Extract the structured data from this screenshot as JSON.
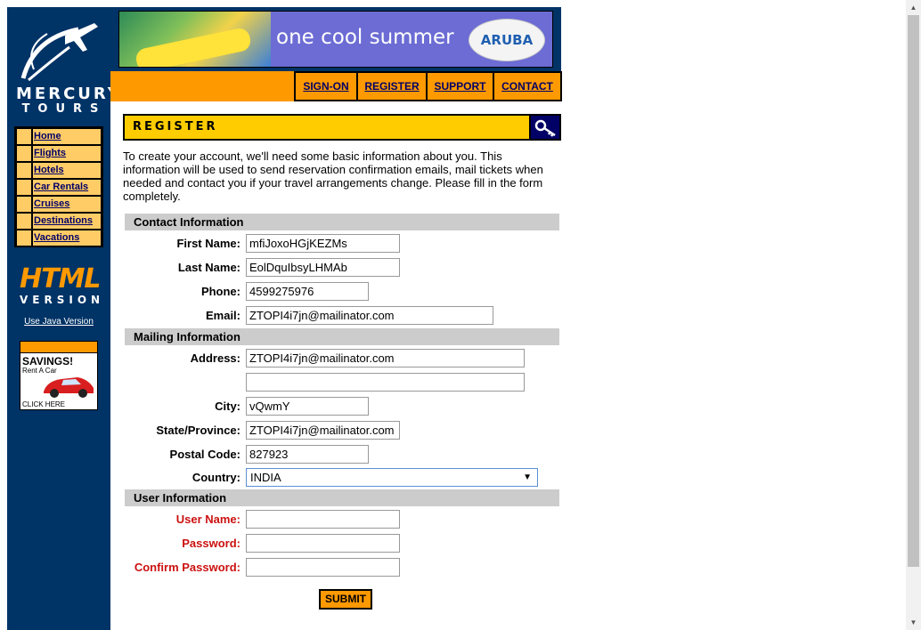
{
  "brand": {
    "line1": "MERCURY",
    "line2": "TOURS"
  },
  "sidebar": {
    "items": [
      {
        "label": "Home"
      },
      {
        "label": "Flights"
      },
      {
        "label": "Hotels"
      },
      {
        "label": "Car Rentals"
      },
      {
        "label": "Cruises"
      },
      {
        "label": "Destinations"
      },
      {
        "label": "Vacations"
      }
    ],
    "html_version_big": "HTML",
    "html_version_small": "VERSION",
    "java_link": "Use Java Version",
    "ad": {
      "headline": "SAVINGS!",
      "sub": "Rent A Car",
      "cta": "CLICK HERE"
    }
  },
  "banner": {
    "text": "one cool summer",
    "logo": "ARUBA"
  },
  "top_menu": [
    "SIGN-ON",
    "REGISTER",
    "SUPPORT",
    "CONTACT"
  ],
  "page": {
    "title": "REGISTER",
    "intro": "To create your account, we'll need some basic information about you. This information will be used to send reservation confirmation emails, mail tickets when needed and contact you if your travel arrangements change. Please fill in the form completely."
  },
  "contact": {
    "header": "Contact Information",
    "first_name_label": "First Name:",
    "first_name": "mfiJoxoHGjKEZMs",
    "last_name_label": "Last Name:",
    "last_name": "EolDquIbsyLHMAb",
    "phone_label": "Phone:",
    "phone": "4599275976",
    "email_label": "Email:",
    "email": "ZTOPI4i7jn@mailinator.com"
  },
  "mailing": {
    "header": "Mailing Information",
    "address_label": "Address:",
    "address1": "ZTOPI4i7jn@mailinator.com",
    "address2": "",
    "city_label": "City:",
    "city": "vQwmY",
    "state_label": "State/Province:",
    "state": "ZTOPI4i7jn@mailinator.com",
    "postal_label": "Postal Code:",
    "postal": "827923",
    "country_label": "Country:",
    "country": "INDIA"
  },
  "user": {
    "header": "User Information",
    "username_label": "User Name:",
    "username": "",
    "password_label": "Password:",
    "password": "",
    "confirm_label": "Confirm Password:",
    "confirm": ""
  },
  "submit_label": "SUBMIT",
  "colors": {
    "navy": "#003366",
    "orange": "#ff9900",
    "yellow": "#ffcc00",
    "link": "#000066",
    "required": "#cc1111"
  }
}
